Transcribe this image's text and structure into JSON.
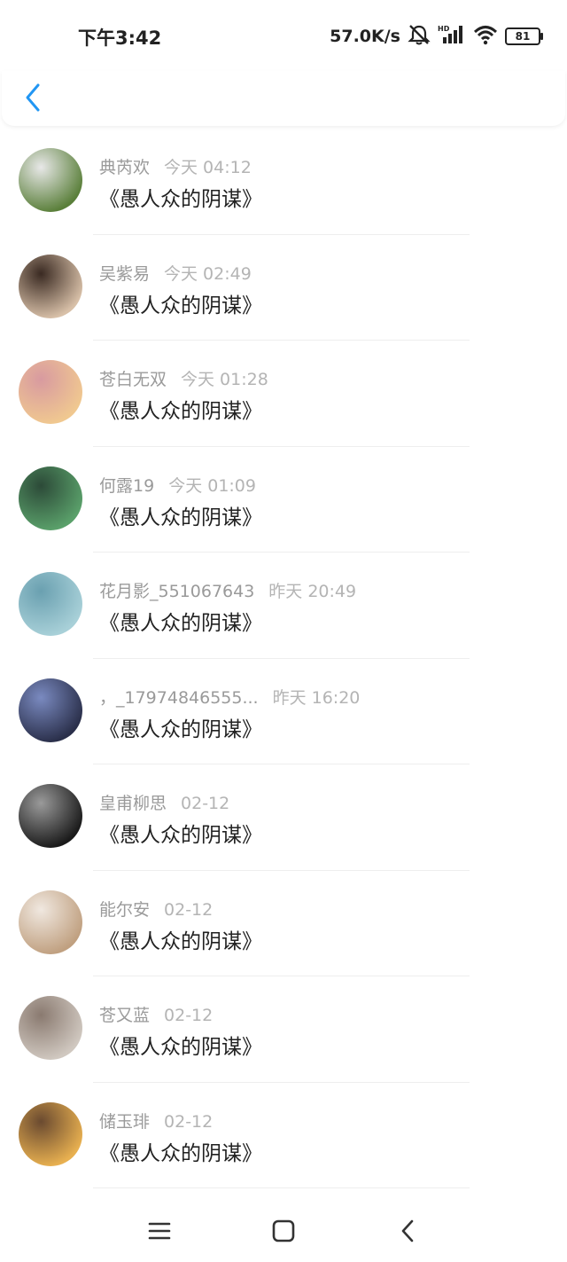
{
  "status_bar": {
    "time": "下午3:42",
    "network_speed": "57.0K/s",
    "icons": [
      "mute-icon",
      "hd-icon",
      "signal-icon",
      "wifi-icon",
      "battery-icon"
    ],
    "battery_level": "81"
  },
  "header": {
    "back_icon": "chevron-left-icon",
    "accent_color": "#2196F3"
  },
  "messages": [
    {
      "name": "典芮欢",
      "time": "今天 04:12",
      "text": "《愚人众的阴谋》",
      "avatar_colors": [
        "#5a7f3a",
        "#e8e8e8"
      ]
    },
    {
      "name": "吴紫易",
      "time": "今天 02:49",
      "text": "《愚人众的阴谋》",
      "avatar_colors": [
        "#d8c0a8",
        "#3a2a22"
      ]
    },
    {
      "name": "苍白无双",
      "time": "今天 01:28",
      "text": "《愚人众的阴谋》",
      "avatar_colors": [
        "#f0c890",
        "#d89aa0"
      ]
    },
    {
      "name": "何露19",
      "time": "今天 01:09",
      "text": "《愚人众的阴谋》",
      "avatar_colors": [
        "#5aa06a",
        "#2c4a38"
      ]
    },
    {
      "name": "花月影_551067643",
      "time": "昨天 20:49",
      "text": "《愚人众的阴谋》",
      "avatar_colors": [
        "#a8d0d8",
        "#6aa0b0"
      ]
    },
    {
      "name": "，_17974846555...",
      "time": "昨天 16:20",
      "text": "《愚人众的阴谋》",
      "avatar_colors": [
        "#2a2f4a",
        "#7a8ac0"
      ]
    },
    {
      "name": "皇甫柳思",
      "time": "02-12",
      "text": "《愚人众的阴谋》",
      "avatar_colors": [
        "#1a1a1a",
        "#9a9a9a"
      ]
    },
    {
      "name": "能尔安",
      "time": "02-12",
      "text": "《愚人众的阴谋》",
      "avatar_colors": [
        "#c0a080",
        "#f0e8e0"
      ]
    },
    {
      "name": "苍又蓝",
      "time": "02-12",
      "text": "《愚人众的阴谋》",
      "avatar_colors": [
        "#d0c8c0",
        "#8a7a70"
      ]
    },
    {
      "name": "储玉琲",
      "time": "02-12",
      "text": "《愚人众的阴谋》",
      "avatar_colors": [
        "#e8b050",
        "#6a4a30"
      ]
    }
  ],
  "nav_bar": {
    "icons": [
      "menu-icon",
      "home-square-icon",
      "back-triangle-icon"
    ]
  }
}
